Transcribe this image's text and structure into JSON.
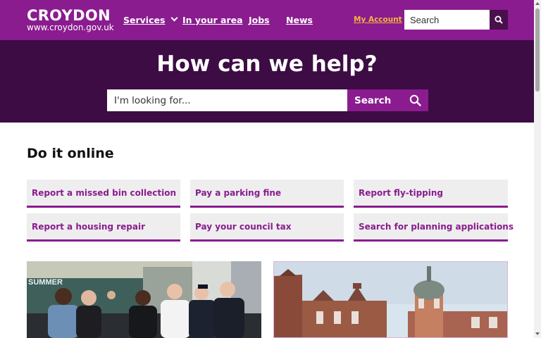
{
  "header": {
    "logo_name": "CROYDON",
    "logo_url_text": "www.croydon.gov.uk",
    "nav": [
      {
        "label": "Services",
        "has_dropdown": true
      },
      {
        "label": "In your area"
      },
      {
        "label": "Jobs"
      },
      {
        "label": "News"
      }
    ],
    "account_label": "My Account",
    "search_placeholder": "Search"
  },
  "hero": {
    "title": "How can we help?",
    "search_placeholder": "I'm looking for...",
    "search_button": "Search"
  },
  "online": {
    "title": "Do it online",
    "tasks": [
      "Report a missed bin collection",
      "Pay a parking fine",
      "Report fly-tipping",
      "Report a housing repair",
      "Pay your council tax",
      "Search for planning applications"
    ]
  },
  "cards": [
    {
      "image": "community-group-photo",
      "visible_sign_text": "SUMMER"
    },
    {
      "image": "croydon-town-hall-clock-tower-photo"
    }
  ],
  "colors": {
    "brand_purple": "#8a1c8f",
    "hero_dark_purple": "#3d0c44",
    "account_link": "#f3b63b",
    "tile_bg": "#eeeeee"
  }
}
